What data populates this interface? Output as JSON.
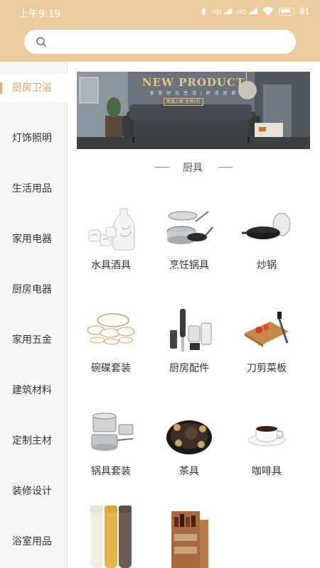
{
  "status_bar": {
    "time": "上午9:19",
    "network1": "HD",
    "network2": "HD",
    "battery": "81"
  },
  "search": {
    "placeholder": ""
  },
  "sidebar": {
    "items": [
      {
        "label": "厨房卫浴",
        "active": true
      },
      {
        "label": "灯饰照明"
      },
      {
        "label": "生活用品"
      },
      {
        "label": "家用电器"
      },
      {
        "label": "厨房电器"
      },
      {
        "label": "家用五金"
      },
      {
        "label": "建筑材料"
      },
      {
        "label": "定制主材"
      },
      {
        "label": "装修设计"
      },
      {
        "label": "浴室用品"
      }
    ]
  },
  "banner": {
    "title": "NEW PRODUCT",
    "subtitle": "享 受 时 尚 生 活 / 舒 适 居 家",
    "button": "新品上新 全场5折"
  },
  "section": {
    "title": "厨具"
  },
  "products": [
    {
      "label": "水具酒具",
      "icon": "sake-set-icon"
    },
    {
      "label": "烹饪锅具",
      "icon": "cookware-set-icon"
    },
    {
      "label": "炒锅",
      "icon": "wok-icon"
    },
    {
      "label": "碗碟套装",
      "icon": "dinnerware-icon"
    },
    {
      "label": "厨房配件",
      "icon": "blender-icon"
    },
    {
      "label": "刀剪菜板",
      "icon": "cutting-board-icon"
    },
    {
      "label": "锅具套装",
      "icon": "pot-set-icon"
    },
    {
      "label": "茶具",
      "icon": "tea-set-icon"
    },
    {
      "label": "咖啡具",
      "icon": "coffee-cup-icon"
    },
    {
      "label": "",
      "icon": "thermos-icon"
    },
    {
      "label": "",
      "icon": "spice-rack-icon"
    }
  ],
  "colors": {
    "header": "#eccb9f",
    "accent": "#d6a264",
    "sidebar_bg": "#f7f7f7"
  }
}
